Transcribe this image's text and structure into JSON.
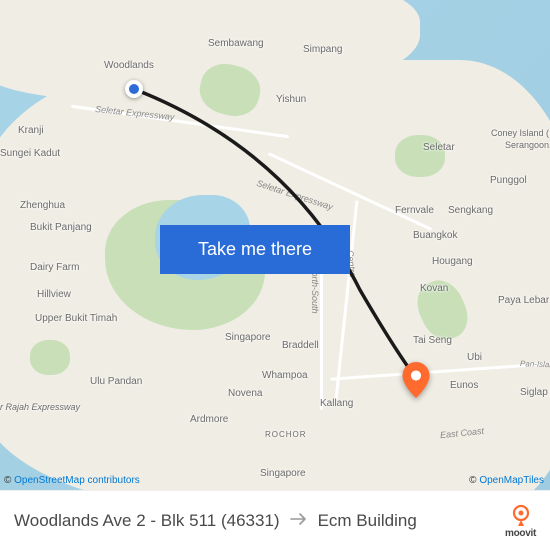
{
  "cta": {
    "label": "Take me there"
  },
  "route": {
    "origin": "Woodlands Ave 2 - Blk 511 (46331)",
    "destination": "Ecm Building"
  },
  "brand": {
    "name": "moovit"
  },
  "attribution": {
    "left_prefix": "© ",
    "left_text": "OpenStreetMap contributors",
    "right_prefix": "© ",
    "right_text": "OpenMapTiles"
  },
  "roads": {
    "seletar_1": "Seletar Expressway",
    "seletar_2": "Seletar Expressway",
    "north_south": "North-South",
    "centra": "Centra",
    "east_coast": "East Coast",
    "pan_island": "Pan-Island Ex"
  },
  "places": {
    "woodlands": "Woodlands",
    "sembawang": "Sembawang",
    "simpang": "Simpang",
    "kranji": "Kranji",
    "sungei_kadut": "Sungei Kadut",
    "yishun": "Yishun",
    "seletar": "Seletar",
    "coney_island": "Coney Island (",
    "serangoon_isl": "Serangoon.",
    "punggol": "Punggol",
    "fernvale": "Fernvale",
    "sengkang": "Sengkang",
    "buangkok": "Buangkok",
    "hougang": "Hougang",
    "kovan": "Kovan",
    "paya_lebar": "Paya Lebar",
    "tai_seng": "Tai Seng",
    "ubi": "Ubi",
    "eunos": "Eunos",
    "siglap": "Siglap",
    "kallang": "Kallang",
    "whampoa": "Whampoa",
    "novena": "Novena",
    "braddell": "Braddell",
    "ardmore": "Ardmore",
    "rochor": "ROCHOR",
    "singapore_label": "Singapore",
    "singapore_city": "Singapore",
    "ulu_pandan": "Ulu Pandan",
    "upper_bukit_timah": "Upper Bukit Timah",
    "hillview": "Hillview",
    "dairy_farm": "Dairy Farm",
    "bukit_panjang": "Bukit Panjang",
    "zhenghua": "Zhenghua",
    "er_rajah_expressway": "er Rajah Expressway"
  }
}
